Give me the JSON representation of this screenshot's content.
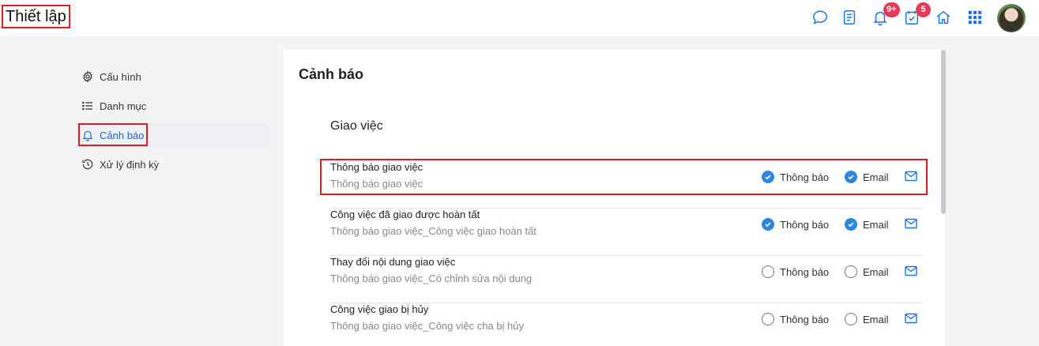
{
  "header": {
    "title": "Thiết lập",
    "icons": [
      {
        "name": "chat-icon",
        "color": "#1a73e8"
      },
      {
        "name": "notes-icon",
        "color": "#1a73e8"
      },
      {
        "name": "bell-icon",
        "color": "#1a73e8",
        "badge": "9+"
      },
      {
        "name": "task-check-icon",
        "color": "#1a73e8",
        "badge": "5"
      },
      {
        "name": "home-icon",
        "color": "#1a73e8"
      },
      {
        "name": "apps-grid-icon",
        "color": "#1a73e8"
      }
    ],
    "badge_color": "#e8375a"
  },
  "sidebar": {
    "items": [
      {
        "label": "Cấu hình",
        "icon": "gear-icon",
        "active": false
      },
      {
        "label": "Danh mục",
        "icon": "list-icon",
        "active": false
      },
      {
        "label": "Cảnh báo",
        "icon": "bell-icon",
        "active": true
      },
      {
        "label": "Xử lý định kỳ",
        "icon": "history-icon",
        "active": false
      }
    ],
    "active_color": "#1a64d6"
  },
  "main": {
    "title": "Cảnh báo",
    "section": "Giao việc",
    "option_labels": {
      "notify": "Thông báo",
      "email": "Email"
    },
    "rows": [
      {
        "title": "Thông báo giao việc",
        "desc": "Thông báo giao việc",
        "notify": true,
        "email": true
      },
      {
        "title": "Công việc đã giao được hoàn tất",
        "desc": "Thông báo giao việc_Công việc giao hoàn tất",
        "notify": true,
        "email": true
      },
      {
        "title": "Thay đổi nội dung giao việc",
        "desc": "Thông báo giao việc_Có chỉnh sửa nội dung",
        "notify": false,
        "email": false
      },
      {
        "title": "Công việc giao bị hủy",
        "desc": "Thông báo giao việc_Công việc cha bị hủy",
        "notify": false,
        "email": false
      }
    ],
    "check_color": "#2e86de"
  }
}
